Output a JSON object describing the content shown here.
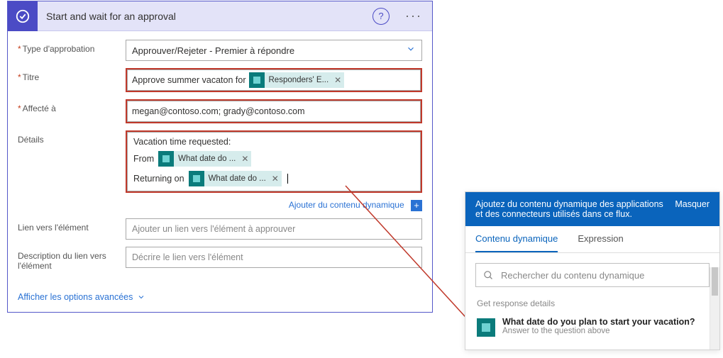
{
  "header": {
    "title": "Start and wait for an approval"
  },
  "fields": {
    "approval_type": {
      "label": "Type d'approbation",
      "value": "Approuver/Rejeter - Premier à répondre"
    },
    "title": {
      "label": "Titre",
      "prefix": "Approve summer vacaton for",
      "token": "Responders' E..."
    },
    "assigned": {
      "label": "Affecté à",
      "value": "megan@contoso.com; grady@contoso.com"
    },
    "details": {
      "label": "Détails",
      "header_text": "Vacation time requested:",
      "from_label": "From",
      "from_token": "What date do ...",
      "return_label": "Returning on",
      "return_token": "What date do ..."
    },
    "link": {
      "label": "Lien vers l'élément",
      "placeholder": "Ajouter un lien vers l'élément à approuver"
    },
    "link_desc": {
      "label": "Description du lien vers l'élément",
      "placeholder": "Décrire le lien vers l'élément"
    }
  },
  "add_dynamic": "Ajouter du contenu dynamique",
  "show_advanced": "Afficher les options avancées",
  "panel": {
    "intro": "Ajoutez du contenu dynamique des applications et des connecteurs utilisés dans ce flux.",
    "hide": "Masquer",
    "tab1": "Contenu dynamique",
    "tab2": "Expression",
    "search_placeholder": "Rechercher du contenu dynamique",
    "section": "Get response details",
    "item_title": "What date do you plan to start your vacation?",
    "item_sub": "Answer to the question above"
  }
}
